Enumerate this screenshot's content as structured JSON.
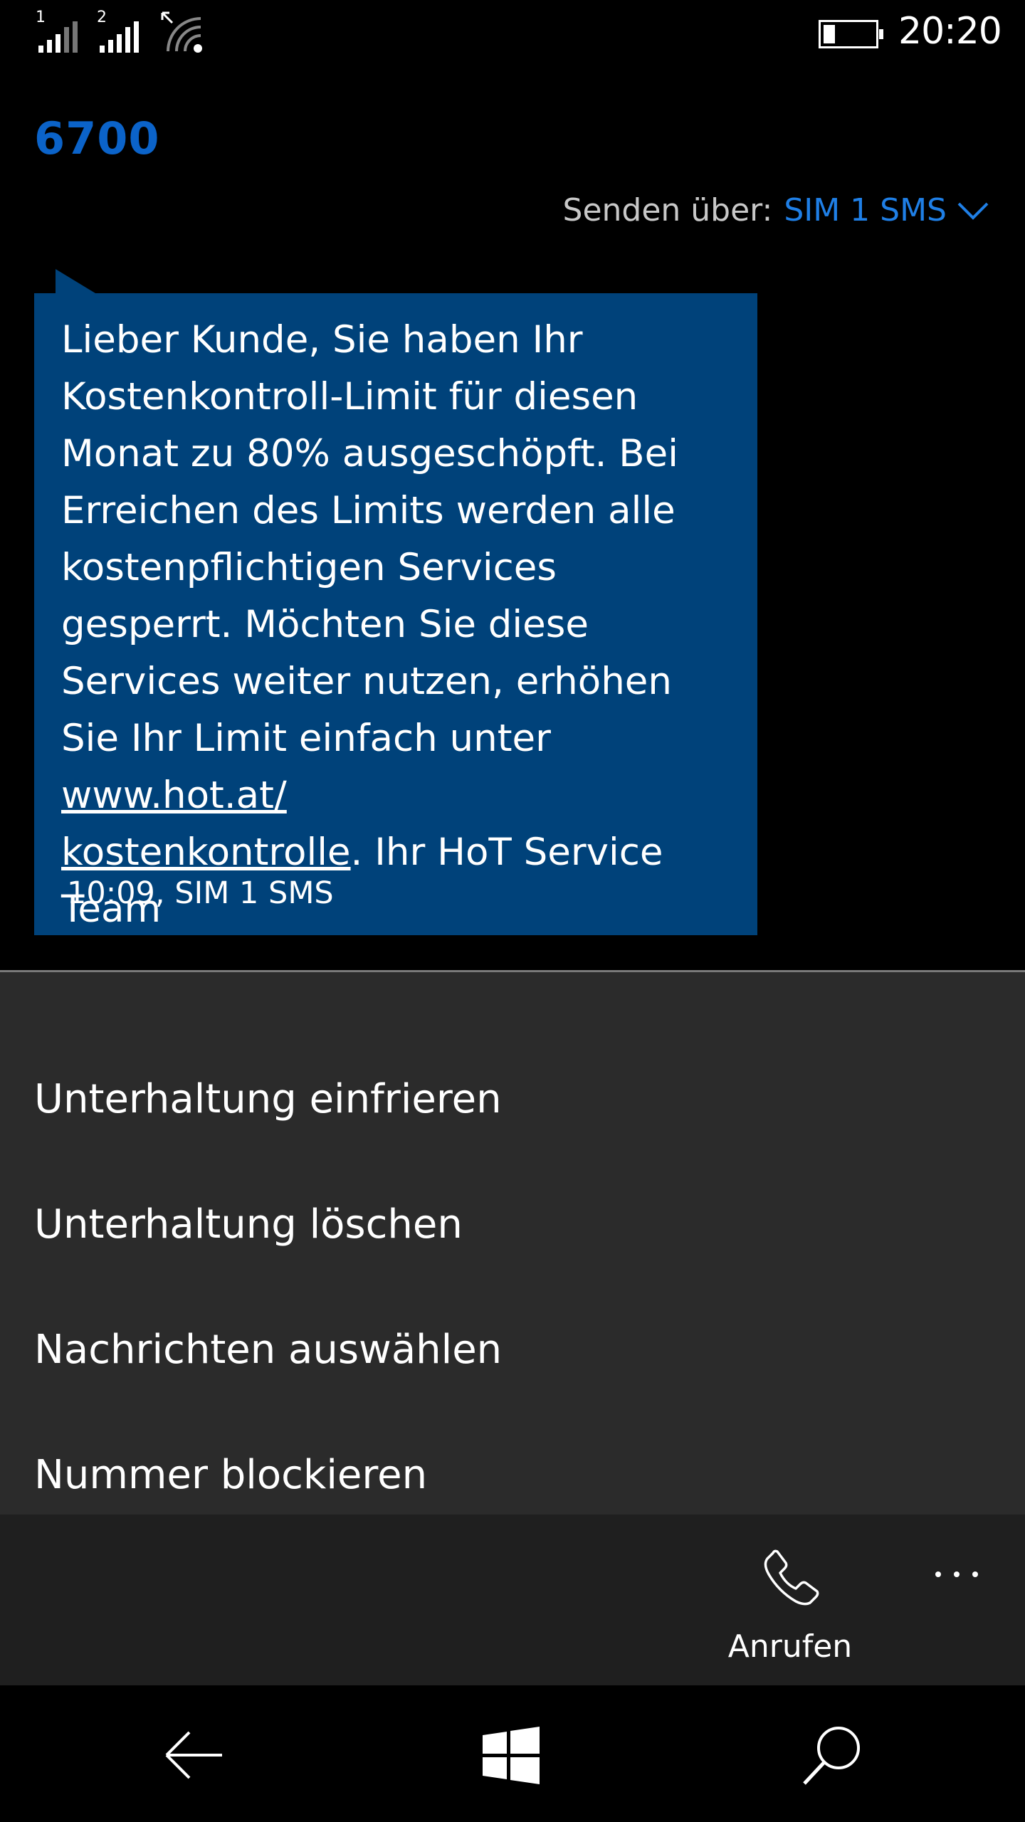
{
  "status_bar": {
    "sim1_label": "1",
    "sim2_label": "2",
    "time": "20:20",
    "battery_level": 0.2,
    "icons": [
      "signal-sim1-icon",
      "signal-sim2-icon",
      "wifi-icon",
      "battery-icon"
    ]
  },
  "conversation": {
    "title": "6700",
    "send_via_label": "Senden über:",
    "send_via_value": "SIM 1 SMS"
  },
  "message": {
    "text_before_link": "Lieber Kunde, Sie haben Ihr Kostenkontroll-Limit für diesen Monat zu 80% ausgeschöpft. Bei Erreichen des Limits werden alle kostenpflichtigen Services gesperrt. Möchten Sie diese Services weiter nutzen, erhöhen Sie Ihr Limit einfach unter ",
    "link_text": "www.hot.at/\nkostenkontrolle",
    "text_after_link": ". Ihr HoT Service\nTeam",
    "meta": "10:09, SIM 1 SMS",
    "bubble_color": "#00427a"
  },
  "menu": {
    "items": [
      {
        "label": "Unterhaltung einfrieren"
      },
      {
        "label": "Unterhaltung löschen"
      },
      {
        "label": "Nachrichten auswählen"
      },
      {
        "label": "Nummer blockieren"
      }
    ]
  },
  "app_bar": {
    "call_label": "Anrufen",
    "call_icon": "phone-icon",
    "more_icon": "more-icon"
  },
  "nav_bar": {
    "icons": [
      "back-arrow-icon",
      "windows-start-icon",
      "search-icon"
    ]
  },
  "colors": {
    "accent": "#0b63c9",
    "link_accent": "#1f7fe6",
    "menu_bg": "#2b2b2b",
    "app_bar_bg": "#1f1f1f"
  }
}
